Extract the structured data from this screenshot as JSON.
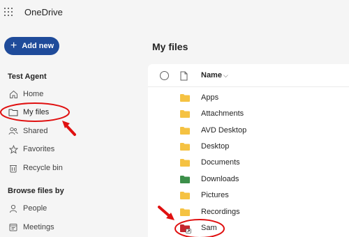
{
  "app": {
    "title": "OneDrive"
  },
  "sidebar": {
    "add_new_label": "Add new",
    "account_heading": "Test Agent",
    "items": [
      {
        "label": "Home",
        "icon": "home-icon"
      },
      {
        "label": "My files",
        "icon": "folder-icon"
      },
      {
        "label": "Shared",
        "icon": "shared-people-icon"
      },
      {
        "label": "Favorites",
        "icon": "star-icon"
      },
      {
        "label": "Recycle bin",
        "icon": "trash-icon"
      }
    ],
    "browse_heading": "Browse files by",
    "browse_items": [
      {
        "label": "People",
        "icon": "person-icon"
      },
      {
        "label": "Meetings",
        "icon": "calendar-icon"
      }
    ]
  },
  "main": {
    "title": "My files",
    "column_name": "Name",
    "files": [
      {
        "name": "Apps",
        "color": "#f5c242"
      },
      {
        "name": "Attachments",
        "color": "#f5c242"
      },
      {
        "name": "AVD Desktop",
        "color": "#f5c242"
      },
      {
        "name": "Desktop",
        "color": "#f5c242"
      },
      {
        "name": "Documents",
        "color": "#f5c242"
      },
      {
        "name": "Downloads",
        "color": "#3c8f4a"
      },
      {
        "name": "Pictures",
        "color": "#f5c242"
      },
      {
        "name": "Recordings",
        "color": "#f5c242"
      },
      {
        "name": "Sam",
        "color": "#c4262e"
      }
    ]
  },
  "colors": {
    "accent": "#1f4b9a",
    "annotation": "#e01010"
  }
}
